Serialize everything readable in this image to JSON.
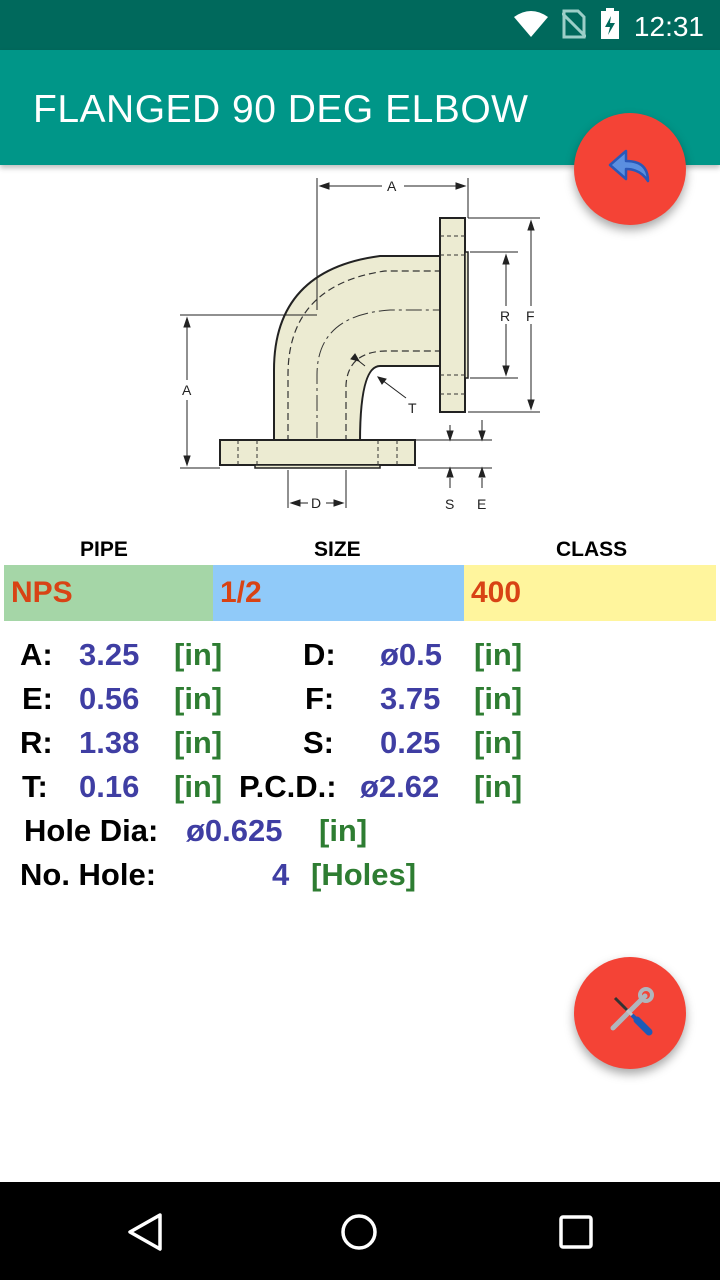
{
  "status_bar": {
    "time": "12:31"
  },
  "app_bar": {
    "title": "FLANGED 90 DEG ELBOW"
  },
  "fab_top": {
    "icon": "undo-arrow-icon"
  },
  "fab_bottom": {
    "icon": "tools-icon"
  },
  "diagram": {
    "labels": {
      "A_top": "A",
      "A_left": "A",
      "R": "R",
      "F": "F",
      "T": "T",
      "D": "D",
      "S": "S",
      "E": "E"
    }
  },
  "selectors": {
    "headers": {
      "pipe": "PIPE",
      "size": "SIZE",
      "class": "CLASS"
    },
    "pipe": "NPS",
    "size": "1/2",
    "class": "400",
    "colors": {
      "pipe": "#a5d6a7",
      "size": "#90caf9",
      "class": "#fff59d"
    }
  },
  "results": {
    "A": {
      "label": "A:",
      "value": "3.25",
      "unit": "[in]"
    },
    "D": {
      "label": "D:",
      "value": "ø0.5",
      "unit": "[in]"
    },
    "E": {
      "label": "E:",
      "value": "0.56",
      "unit": "[in]"
    },
    "F": {
      "label": "F:",
      "value": "3.75",
      "unit": "[in]"
    },
    "R": {
      "label": "R:",
      "value": "1.38",
      "unit": "[in]"
    },
    "S": {
      "label": "S:",
      "value": "0.25",
      "unit": "[in]"
    },
    "T": {
      "label": "T:",
      "value": "0.16",
      "unit": "[in]"
    },
    "PCD": {
      "label": "P.C.D.:",
      "value": "ø2.62",
      "unit": "[in]"
    },
    "hole_dia": {
      "label": "Hole Dia:",
      "value": "ø0.625",
      "unit": "[in]"
    },
    "no_hole": {
      "label": "No. Hole:",
      "value": "4",
      "unit": "[Holes]"
    }
  }
}
